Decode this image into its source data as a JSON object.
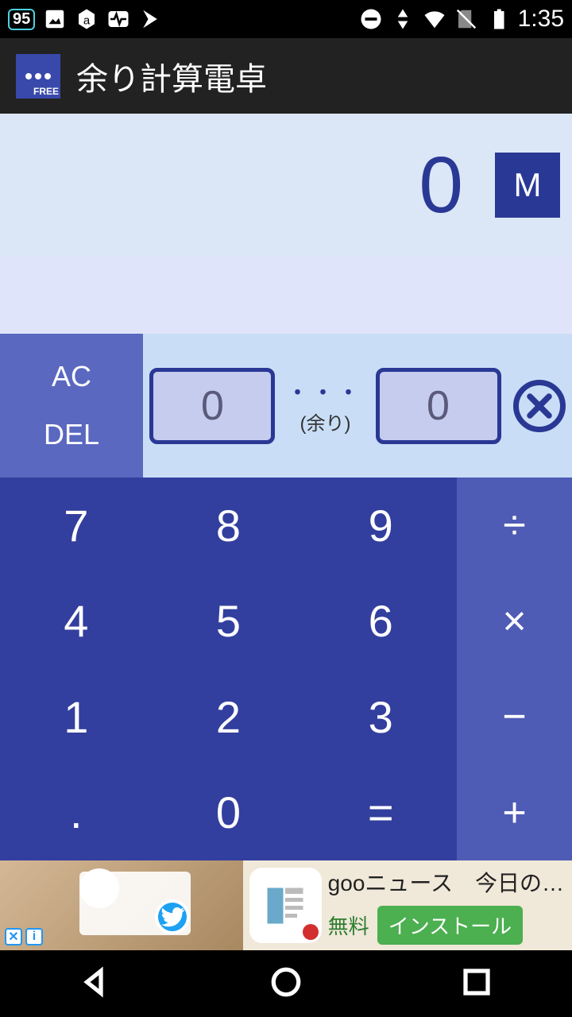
{
  "status": {
    "battery_badge": "95",
    "time": "1:35"
  },
  "app": {
    "title": "余り計算電卓",
    "icon_free": "FREE"
  },
  "display": {
    "main_value": "0",
    "memory_label": "M"
  },
  "controls": {
    "ac": "AC",
    "del": "DEL"
  },
  "remainder": {
    "quotient": "0",
    "dots": "・・・",
    "label": "(余り)",
    "remainder_value": "0"
  },
  "keypad": {
    "keys": [
      "7",
      "8",
      "9",
      "4",
      "5",
      "6",
      "1",
      "2",
      "3",
      ".",
      "0",
      "="
    ],
    "ops": [
      "÷",
      "×",
      "−",
      "+"
    ]
  },
  "ad": {
    "headline": "gooニュース　今日の…",
    "free_label": "無料",
    "install": "インストール"
  }
}
